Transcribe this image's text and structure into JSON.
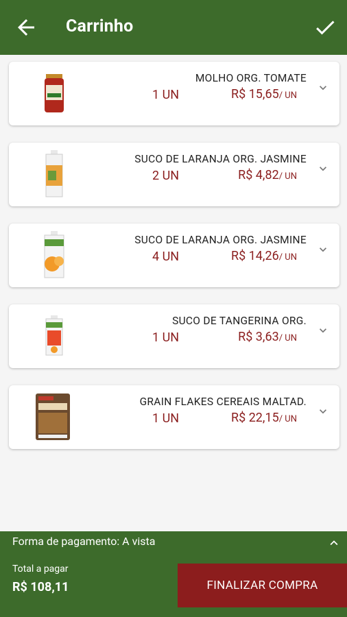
{
  "header": {
    "title": "Carrinho"
  },
  "items": [
    {
      "name": "MOLHO ORG. TOMATE",
      "qty": "1 UN",
      "price": "R$ 15,65",
      "unit": "/ UN"
    },
    {
      "name": "SUCO DE LARANJA ORG. JASMINE",
      "qty": "2 UN",
      "price": "R$ 4,82",
      "unit": "/ UN"
    },
    {
      "name": "SUCO DE LARANJA ORG. JASMINE",
      "qty": "4 UN",
      "price": "R$ 14,26",
      "unit": "/ UN"
    },
    {
      "name": "SUCO DE TANGERINA ORG.",
      "qty": "1 UN",
      "price": "R$ 3,63",
      "unit": "/ UN"
    },
    {
      "name": "GRAIN FLAKES CEREAIS MALTAD.",
      "qty": "1 UN",
      "price": "R$ 22,15",
      "unit": "/ UN"
    }
  ],
  "footer": {
    "payment_text": "Forma de pagamento: A vista",
    "total_label": "Total a pagar",
    "total_value": "R$ 108,11",
    "finish_label": "FINALIZAR COMPRA"
  },
  "colors": {
    "primary": "#3d6b2b",
    "accent": "#8c1d1d",
    "price": "#8b1f1f"
  }
}
